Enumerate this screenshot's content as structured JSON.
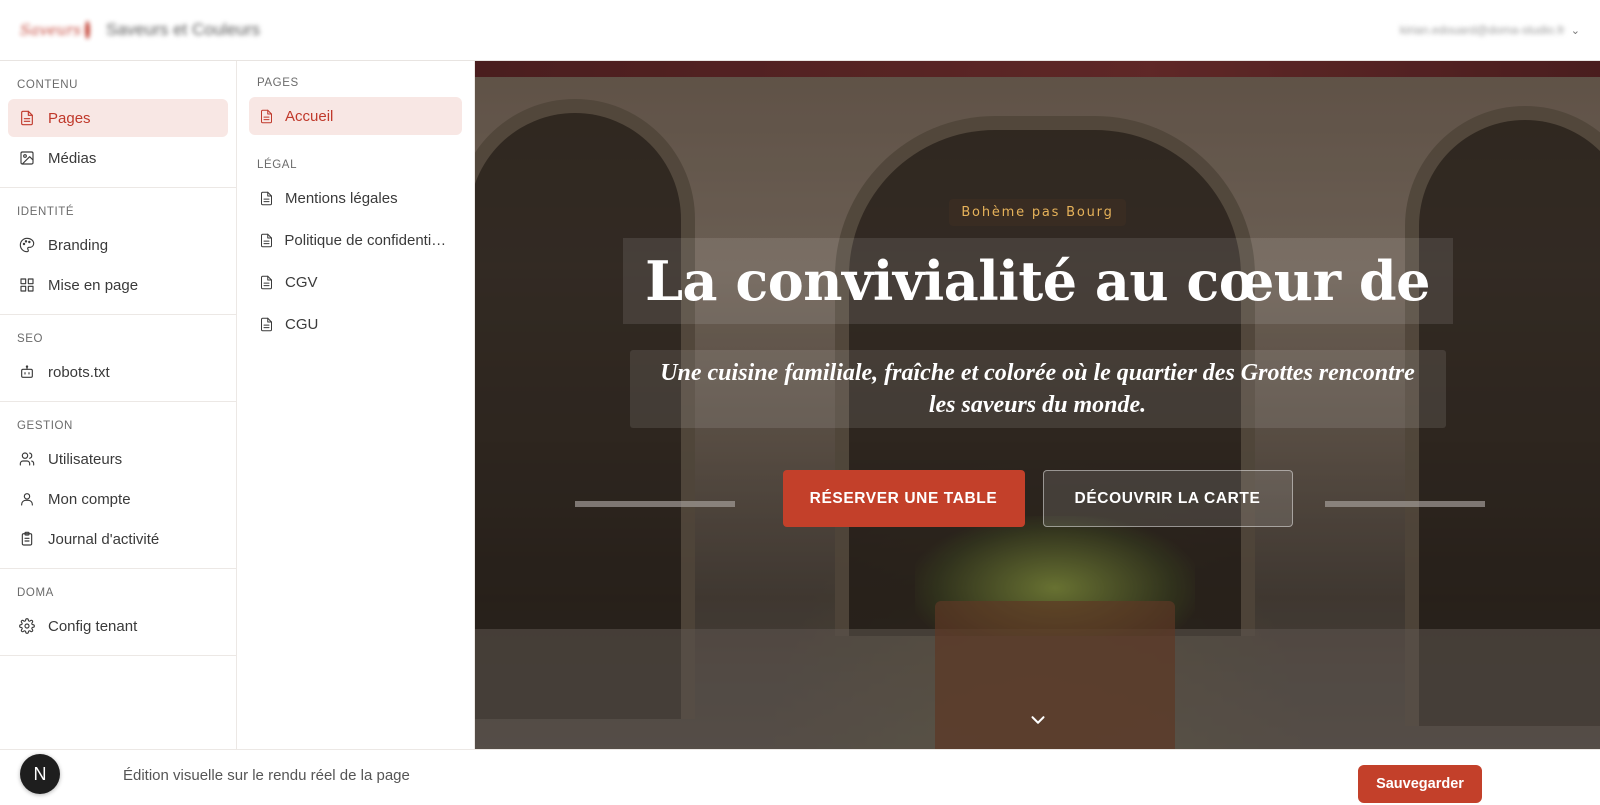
{
  "header": {
    "logo_text": "Saveurs",
    "site_name": "Saveurs et Couleurs",
    "user_email": "kirian.edouard@doma-studio.fr",
    "menu_chevron_icon": "chevron-down-icon"
  },
  "sidebar": {
    "sections": [
      {
        "title": "CONTENU",
        "items": [
          {
            "label": "Pages",
            "icon": "file-icon",
            "active": true
          },
          {
            "label": "Médias",
            "icon": "image-icon",
            "active": false
          }
        ]
      },
      {
        "title": "IDENTITÉ",
        "items": [
          {
            "label": "Branding",
            "icon": "palette-icon",
            "active": false
          },
          {
            "label": "Mise en page",
            "icon": "layout-grid-icon",
            "active": false
          }
        ]
      },
      {
        "title": "SEO",
        "items": [
          {
            "label": "robots.txt",
            "icon": "bot-icon",
            "active": false
          }
        ]
      },
      {
        "title": "GESTION",
        "items": [
          {
            "label": "Utilisateurs",
            "icon": "users-icon",
            "active": false
          },
          {
            "label": "Mon compte",
            "icon": "user-icon",
            "active": false
          },
          {
            "label": "Journal d'activité",
            "icon": "clipboard-icon",
            "active": false
          }
        ]
      },
      {
        "title": "DOMA",
        "items": [
          {
            "label": "Config tenant",
            "icon": "gear-icon",
            "active": false
          }
        ]
      }
    ]
  },
  "pages_panel": {
    "groups": [
      {
        "title": "PAGES",
        "items": [
          {
            "label": "Accueil",
            "icon": "file-icon",
            "active": true
          }
        ]
      },
      {
        "title": "LÉGAL",
        "items": [
          {
            "label": "Mentions légales",
            "icon": "file-icon",
            "active": false
          },
          {
            "label": "Politique de confidentialité",
            "icon": "file-icon",
            "active": false
          },
          {
            "label": "CGV",
            "icon": "file-icon",
            "active": false
          },
          {
            "label": "CGU",
            "icon": "file-icon",
            "active": false
          }
        ]
      }
    ]
  },
  "preview": {
    "eyebrow": "Bohème pas Bourg",
    "headline": "La convivialité au cœur de",
    "subtitle": "Une cuisine familiale, fraîche et colorée où le quartier des Grottes rencontre les saveurs du monde.",
    "cta_primary": "RÉSERVER UNE TABLE",
    "cta_secondary": "DÉCOUVRIR LA CARTE",
    "scroll_icon": "chevron-down-icon"
  },
  "footer": {
    "avatar_letter": "N",
    "hint": "Édition visuelle sur le rendu réel de la page",
    "save_label": "Sauvegarder"
  },
  "colors": {
    "accent": "#c3402a",
    "active_bg": "#f8e7e4",
    "eyebrow": "#e6b25a"
  }
}
